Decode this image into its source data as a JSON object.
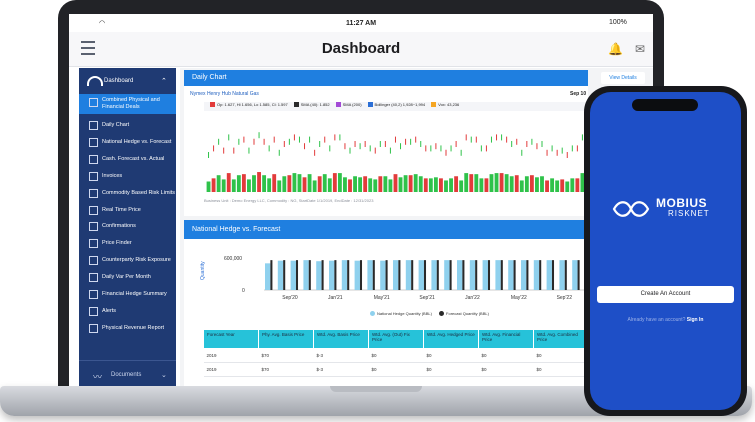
{
  "status": {
    "time": "11:27 AM",
    "wifi": "wifi-icon",
    "battery": "100%"
  },
  "header": {
    "title": "Dashboard",
    "menu_icon": "hamburger-icon",
    "bell_icon": "bell-icon",
    "mail_icon": "mail-icon"
  },
  "sidebar": {
    "dashboard_label": "Dashboard",
    "items": [
      {
        "label": "Combined Physical and Financial Deals",
        "active": true
      },
      {
        "label": "Daily Chart"
      },
      {
        "label": "National Hedge vs. Forecast"
      },
      {
        "label": "Cash. Forecast vs. Actual"
      },
      {
        "label": "Invoices"
      },
      {
        "label": "Commodity Based Risk Limits"
      },
      {
        "label": "Real Time Price"
      },
      {
        "label": "Confirmations"
      },
      {
        "label": "Price Finder"
      },
      {
        "label": "Counterparty Risk Exposure"
      },
      {
        "label": "Daily Var Per Month"
      },
      {
        "label": "Financial Hedge Summary"
      },
      {
        "label": "Alerts"
      },
      {
        "label": "Physical Revenue Report"
      }
    ],
    "documents_label": "Documents"
  },
  "daily_chart": {
    "title": "Daily Chart",
    "view_details": "View Details",
    "subtitle": "Nymex Henry Hub Natural Gas",
    "date": "Sep 10",
    "legend": [
      {
        "label": "Op: 1.627, Hi 1.656, Lo 1.585, Cl: 1.597",
        "color": "#e23b3b"
      },
      {
        "label": "SMA (40): 1.852",
        "color": "#2a2a2a"
      },
      {
        "label": "SMA (200)",
        "color": "#a34ad6"
      },
      {
        "label": "Bollinger (40,2) 1,928~1,994",
        "color": "#2b6fd6"
      },
      {
        "label": "Vox: 43,236",
        "color": "#f5a623"
      }
    ],
    "info": "Business Unit : Demo Energy LLC, Commodity : NG, StartDate 1/1/2019, EndDate : 12/31/2023"
  },
  "chart_data": [
    {
      "type": "bar",
      "series": [
        {
          "name": "Op: 1.627, Hi 1.656, Lo 1.585, Cl: 1.597",
          "values": [
            10,
            13,
            16,
            12,
            18,
            12,
            16,
            17,
            12,
            16,
            19,
            16,
            13,
            17,
            11,
            15,
            16,
            18,
            17,
            14,
            17,
            11,
            15,
            17,
            13,
            18,
            18,
            14,
            12,
            15,
            14,
            15,
            13,
            12,
            15,
            15,
            12,
            17,
            14,
            16,
            16,
            17,
            15,
            13,
            13,
            14,
            13,
            11,
            13,
            15,
            11,
            18,
            17,
            17,
            13,
            13,
            17,
            18,
            18,
            17,
            15,
            16,
            11,
            15,
            16,
            14,
            15,
            11,
            13,
            11,
            12,
            10,
            13,
            13,
            18,
            14
          ]
        }
      ]
    },
    {
      "type": "bar",
      "title": "National Hedge vs. Forecast",
      "ylabel": "Quantity",
      "yticks": [
        "600,000",
        "0"
      ],
      "categories": [
        "Sep'20",
        "Jan'21",
        "May'21",
        "Sep'21",
        "Jan'22",
        "May'22",
        "Sep'22"
      ],
      "series": [
        {
          "name": "National Hedge Quantity (BBL)",
          "values": [
            500000,
            550000,
            550000,
            560000,
            540000,
            550000,
            560000,
            550000,
            560000,
            550000,
            560000,
            560000,
            560000,
            560000,
            560000,
            560000,
            560000,
            560000,
            560000,
            560000,
            560000,
            560000,
            560000,
            560000,
            560000
          ]
        },
        {
          "name": "Forecast Quantity (BBL)",
          "values": [
            560000,
            560000,
            560000,
            560000,
            560000,
            560000,
            560000,
            560000,
            560000,
            560000,
            560000,
            560000,
            560000,
            560000,
            560000,
            560000,
            560000,
            560000,
            560000,
            560000,
            560000,
            560000,
            560000,
            560000,
            560000
          ]
        }
      ],
      "colors": {
        "hedge": "#8fd1ee",
        "forecast": "#2a2a2a"
      }
    }
  ],
  "hedge": {
    "title": "National Hedge vs. Forecast",
    "ylabel": "Quantity",
    "ytick_top": "600,000",
    "ytick_zero": "0",
    "legend": {
      "hedge": "National Hedge Quantity (BBL)",
      "forecast": "Forecast Quantity (BBL)"
    },
    "table": {
      "headers": [
        "Forecast Year",
        "Phy. Avg. Basis Price",
        "Wtd. Avg. Basis Price",
        "Wtd. Avg. (Out) Fix Price",
        "Wtd. Avg. Hedged Price",
        "Wtd. Avg. Financial Price",
        "Wtd. Avg. Combined Price"
      ],
      "rows": [
        [
          "2019",
          "$70",
          "$-3",
          "$0",
          "$0",
          "$0",
          "$0"
        ],
        [
          "2019",
          "$70",
          "$-3",
          "$0",
          "$0",
          "$0",
          "$0"
        ]
      ]
    }
  },
  "phone": {
    "brand_top": "MOBIUS",
    "brand_bottom": "RISKNET",
    "create_account": "Create An Account",
    "signin_prompt": "Already have an account?",
    "signin_link": "Sign In"
  }
}
